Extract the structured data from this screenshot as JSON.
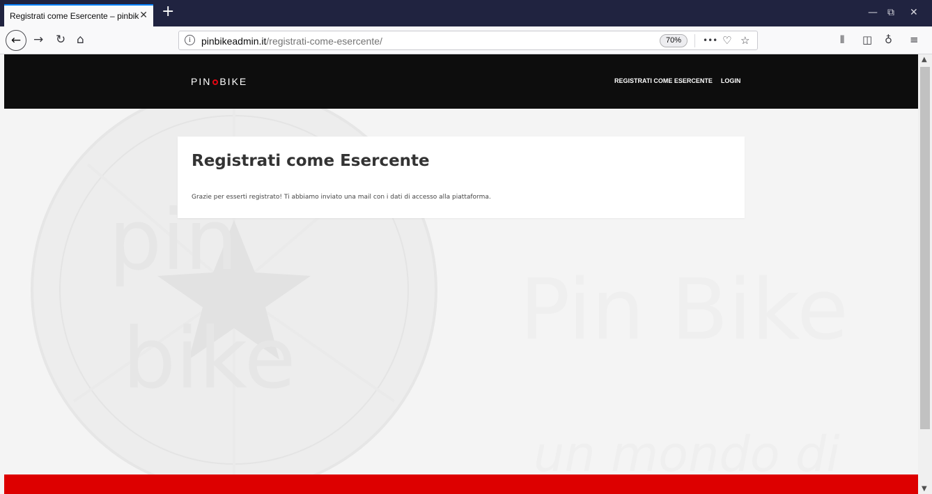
{
  "browser": {
    "tab_title": "Registrati come Esercente – pinbike",
    "tab_close": "✕",
    "new_tab": "+",
    "url_domain": "pinbikeadmin.it",
    "url_path": "/registrati-come-esercente/",
    "zoom": "70%",
    "page_actions": "•••",
    "window_controls": {
      "minimize": "—",
      "restore": "⧉",
      "close": "✕"
    }
  },
  "site": {
    "logo_left": "PIN",
    "logo_right": "BIKE",
    "nav": [
      "REGISTRATI COME ESERCENTE",
      "LOGIN"
    ],
    "background_text": {
      "main": "Pin Bike",
      "sub": "un mondo di",
      "wheel_top": "pin",
      "wheel_bottom": "bike"
    }
  },
  "main": {
    "title": "Registrati come Esercente",
    "message": "Grazie per esserti registrato! Ti abbiamo inviato una mail con i dati di accesso alla piattaforma."
  },
  "colors": {
    "accent_red": "#dd0000",
    "header_black": "#0d0d0d",
    "tab_highlight": "#0a84ff"
  }
}
